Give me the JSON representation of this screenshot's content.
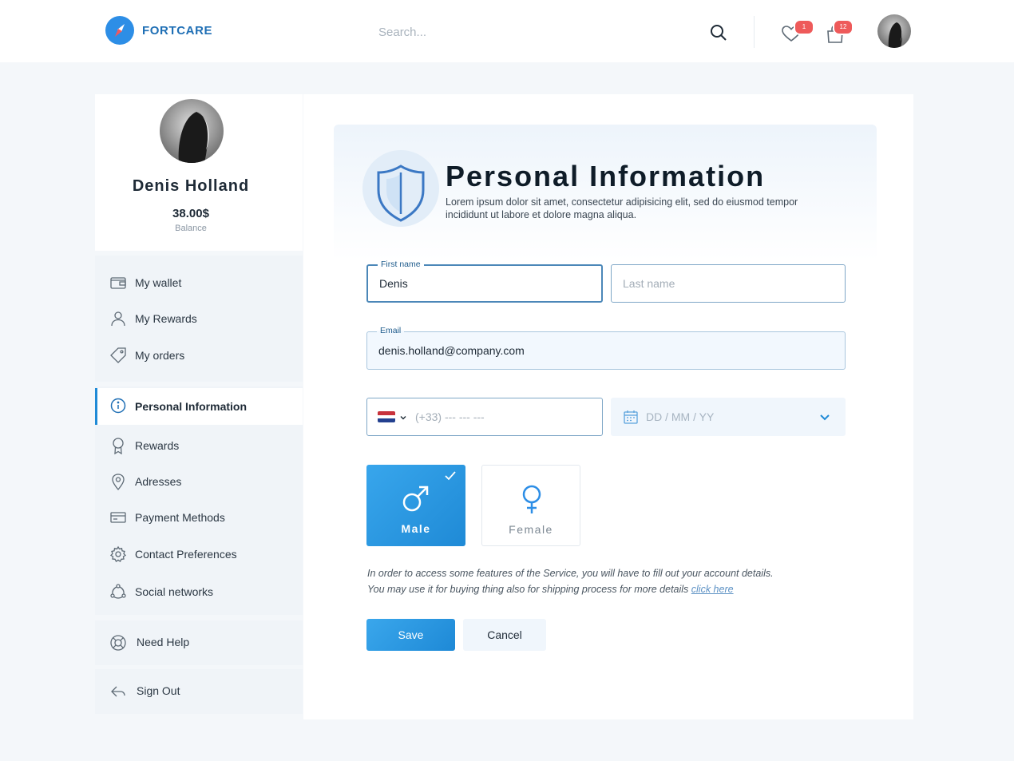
{
  "app": {
    "name": "FORTCARE"
  },
  "topbar": {
    "search_placeholder": "Search...",
    "wishlist_count": "1",
    "cart_count": "12"
  },
  "profile": {
    "name": "Denis Holland",
    "balance": "38.00$",
    "balance_label": "Balance"
  },
  "sidebar": {
    "group1": [
      {
        "label": "My wallet",
        "icon": "wallet-icon"
      },
      {
        "label": "My Rewards",
        "icon": "user-icon"
      },
      {
        "label": "My orders",
        "icon": "tag-icon"
      }
    ],
    "group2": [
      {
        "label": "Personal Information",
        "icon": "info-icon",
        "active": true
      },
      {
        "label": "Rewards",
        "icon": "award-icon"
      },
      {
        "label": "Adresses",
        "icon": "location-pin-icon"
      },
      {
        "label": "Payment Methods",
        "icon": "credit-card-icon"
      },
      {
        "label": "Contact Preferences",
        "icon": "gear-icon"
      },
      {
        "label": "Social networks",
        "icon": "share-icon"
      }
    ],
    "help_label": "Need Help",
    "signout_label": "Sign Out"
  },
  "form": {
    "title": "Personal Information",
    "description": "Lorem ipsum dolor sit amet, consectetur adipisicing elit, sed do eiusmod tempor incididunt ut labore et dolore magna aliqua.",
    "first_name_label": "First name",
    "first_name_value": "Denis",
    "last_name_placeholder": "Last name",
    "email_label": "Email",
    "email_value": "denis.holland@company.com",
    "phone_placeholder": "(+33) --- --- ---",
    "phone_country": "NL",
    "date_placeholder": "DD / MM / YY",
    "gender_male": "Male",
    "gender_female": "Female",
    "gender_selected": "Male",
    "note_line1": "In order to access some features of the Service, you will have to fill out your account details.",
    "note_line2": "You may use it for buying thing also for shipping process for more details ",
    "note_link": "click here",
    "save_label": "Save",
    "cancel_label": "Cancel"
  },
  "colors": {
    "accent": "#1f8ad6",
    "brand": "#1f6fb5",
    "badge": "#ee5a5a"
  }
}
